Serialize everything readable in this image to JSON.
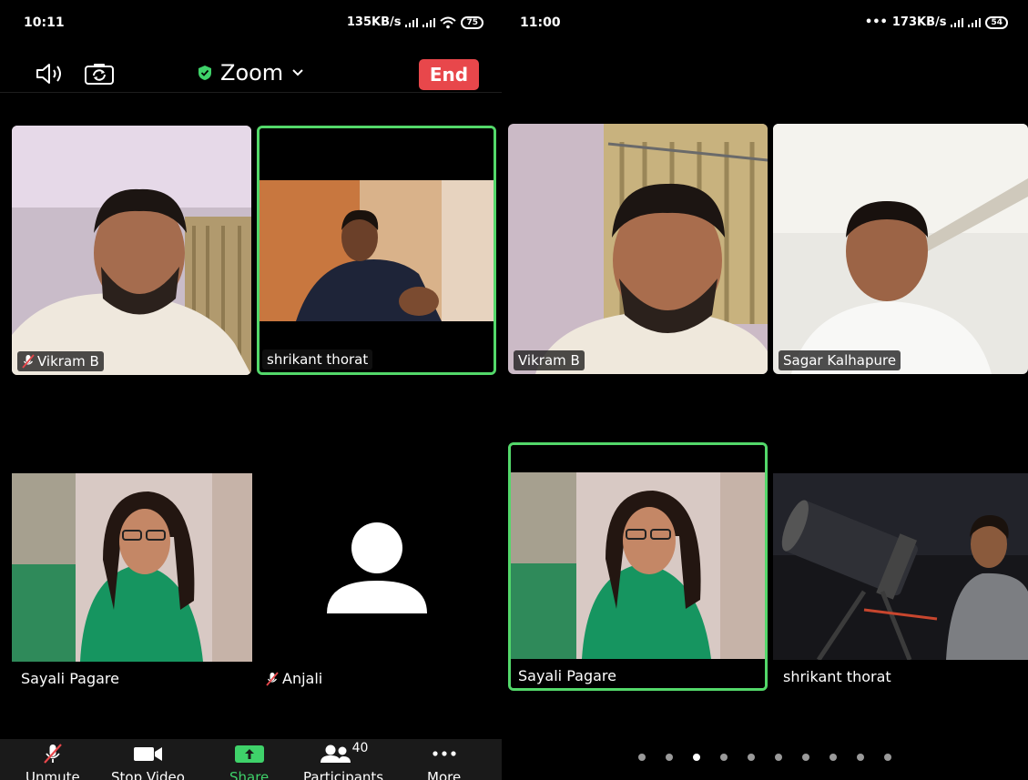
{
  "left_screen": {
    "status_bar": {
      "time": "10:11",
      "network_speed": "135KB/s",
      "battery": "75"
    },
    "top_bar": {
      "meeting_title": "Zoom",
      "end_label": "End"
    },
    "participants": [
      {
        "name": "Vikram B",
        "muted": true
      },
      {
        "name": "shrikant thorat",
        "muted": false,
        "active_speaker": true
      },
      {
        "name": "Sayali Pagare",
        "muted": false
      },
      {
        "name": "Anjali",
        "muted": true,
        "video_off": true
      }
    ],
    "toolbar": {
      "unmute_label": "Unmute",
      "stop_video_label": "Stop Video",
      "share_label": "Share",
      "participants_label": "Participants",
      "participants_count": "40",
      "more_label": "More"
    },
    "colors": {
      "end_button": "#e8474b",
      "active_border": "#53d86a",
      "share_accent": "#3fd26a"
    }
  },
  "right_screen": {
    "status_bar": {
      "time": "11:00",
      "network_speed": "173KB/s",
      "battery": "54"
    },
    "participants": [
      {
        "name": "Vikram B"
      },
      {
        "name": "Sagar Kalhapure"
      },
      {
        "name": "Sayali Pagare",
        "active_speaker": true
      },
      {
        "name": "shrikant thorat"
      }
    ],
    "pagination": {
      "total_pages": 10,
      "current_page": 3
    }
  }
}
